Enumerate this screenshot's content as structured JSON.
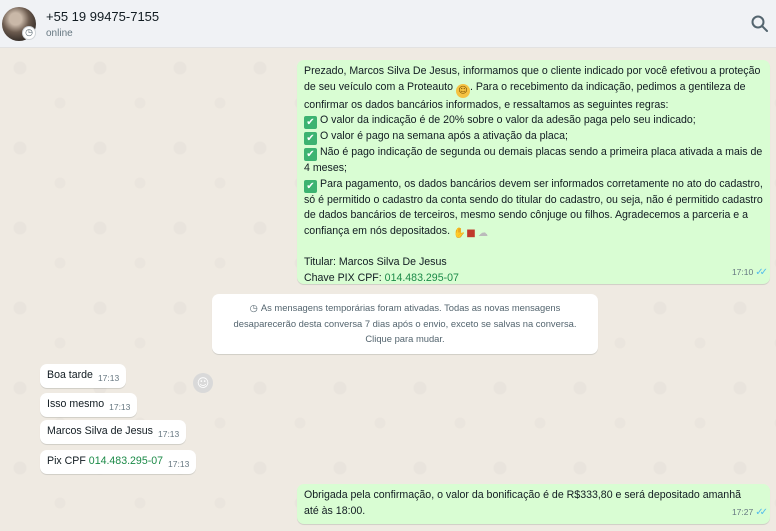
{
  "header": {
    "contact_name": "+55 19 99475-7155",
    "status": "online"
  },
  "messages": {
    "msg1": {
      "intro": "Prezado, Marcos Silva De Jesus, informamos que o cliente indicado por você efetivou a proteção de seu veículo com a Proteauto",
      "intro2": ". Para o recebimento da indicação, pedimos a gentileza de confirmar os dados bancários informados, e  ressaltamos as seguintes regras:",
      "rule1": "O valor da indicação é de 20% sobre o valor da adesão paga pelo seu indicado;",
      "rule2": "O valor é pago na semana após a ativação da placa;",
      "rule3": "Não é pago indicação de segunda ou demais placas sendo a primeira placa ativada a mais de 4 meses;",
      "rule4": "Para pagamento, os dados bancários devem ser informados corretamente no ato do cadastro, só é permitido o cadastro da conta sendo do titular do cadastro, ou seja, não é permitido cadastro de dados bancários de terceiros, mesmo sendo cônjuge ou filhos. Agradecemos a parceria e a confiança em nós depositados.",
      "titular": "Titular: Marcos Silva De Jesus",
      "pix_label": "Chave PIX CPF: ",
      "pix_value": "014.483.295-07",
      "time": "17:10"
    },
    "system_notice": {
      "line1": "As mensagens temporárias foram ativadas. Todas as novas mensagens",
      "line2": "desaparecerão desta conversa 7 dias após o envio, exceto se salvas na conversa.",
      "line3": "Clique para mudar."
    },
    "in1": {
      "text": "Boa tarde",
      "time": "17:13"
    },
    "in2": {
      "text": "Isso mesmo",
      "time": "17:13"
    },
    "in3": {
      "text": "Marcos Silva de Jesus",
      "time": "17:13"
    },
    "in4": {
      "label": "Pix CPF ",
      "value": "014.483.295-07",
      "time": "17:13"
    },
    "msg2": {
      "line1": "Obrigada pela confirmação, o valor da bonificação é de R$333,80 e será depositado amanhã",
      "line2": "até às 18:00.",
      "time": "17:27"
    }
  },
  "icons": {
    "search": "search-icon",
    "check": "check-mark-button-emoji",
    "smile": "smiling-face-emoji",
    "timer": "timer-icon",
    "react": "emoji-reaction-icon"
  },
  "colors": {
    "outgoing_bubble": "#d9fdd3",
    "incoming_bubble": "#ffffff",
    "read_ticks": "#53bdeb",
    "chat_background": "#efeae2"
  }
}
